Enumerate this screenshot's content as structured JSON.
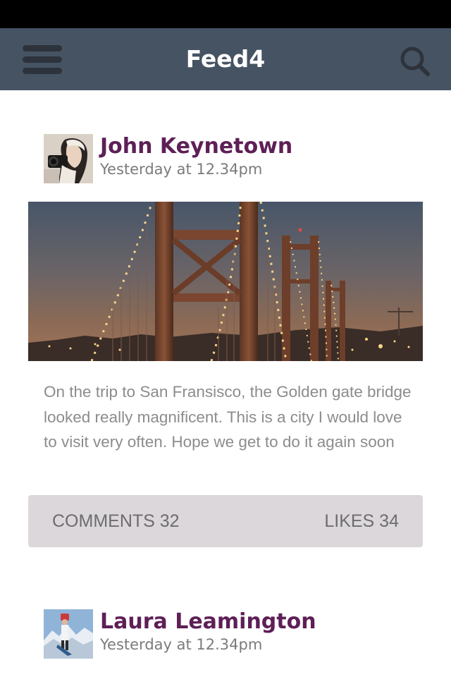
{
  "app": {
    "title": "Feed4"
  },
  "icons": {
    "menu": "hamburger-icon",
    "search": "search-icon"
  },
  "colors": {
    "nav_background": "#465363",
    "author_name": "#5e1f56",
    "actions_background": "#dcd7db"
  },
  "posts": [
    {
      "author": "John Keynetown",
      "timestamp": "Yesterday at 12.34pm",
      "image": "golden-gate-bridge-at-night",
      "text": "On the trip to San Fransisco, the Golden gate bridge looked really magnificent. This is a city I would love to visit very often. Hope we get to do it again soon",
      "comments_label": "COMMENTS 32",
      "likes_label": "LIKES 34"
    },
    {
      "author": "Laura Leamington",
      "timestamp": "Yesterday at 12.34pm"
    }
  ]
}
